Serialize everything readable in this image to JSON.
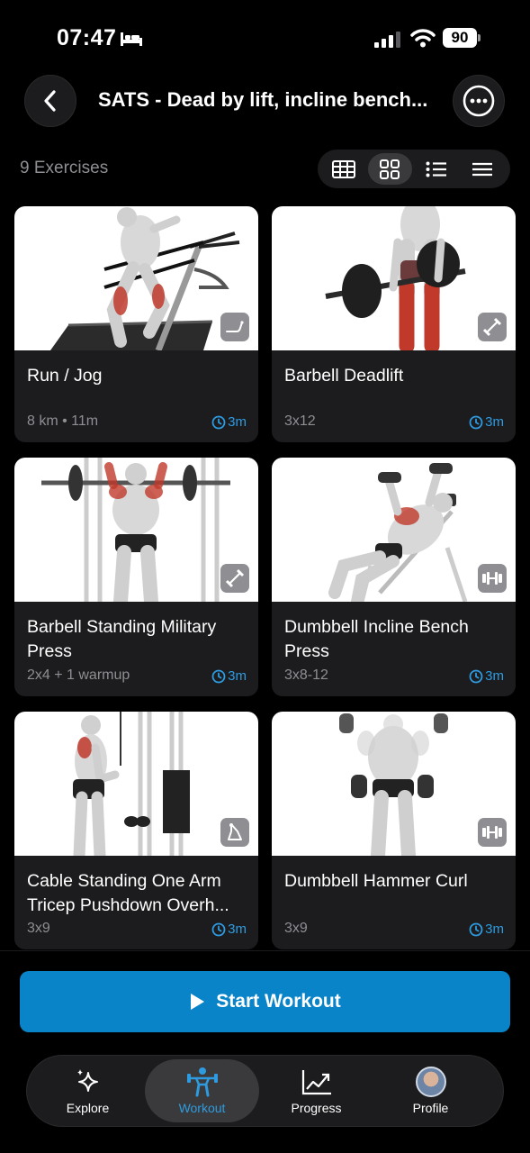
{
  "status_bar": {
    "time": "07:47",
    "battery": "90"
  },
  "header": {
    "title": "SATS - Dead by lift, incline bench..."
  },
  "summary": {
    "count_label": "9 Exercises"
  },
  "view_modes": [
    "table",
    "grid",
    "list",
    "compact"
  ],
  "exercises": [
    {
      "name": "Run / Jog",
      "detail": "8 km • 11m",
      "duration": "3m",
      "equipment_icon": "treadmill-icon"
    },
    {
      "name": "Barbell Deadlift",
      "detail": "3x12",
      "duration": "3m",
      "equipment_icon": "barbell-icon"
    },
    {
      "name": "Barbell Standing Military Press",
      "detail": "2x4 + 1 warmup",
      "duration": "3m",
      "equipment_icon": "barbell-icon"
    },
    {
      "name": "Dumbbell Incline Bench Press",
      "detail": "3x8-12",
      "duration": "3m",
      "equipment_icon": "dumbbell-icon"
    },
    {
      "name": "Cable Standing One Arm Tricep Pushdown Overh...",
      "detail": "3x9",
      "duration": "3m",
      "equipment_icon": "cable-icon"
    },
    {
      "name": "Dumbbell Hammer Curl",
      "detail": "3x9",
      "duration": "3m",
      "equipment_icon": "dumbbell-icon"
    }
  ],
  "actions": {
    "start_label": "Start Workout"
  },
  "tabs": [
    {
      "label": "Explore",
      "icon": "sparkles-icon"
    },
    {
      "label": "Workout",
      "icon": "lifter-icon",
      "active": true
    },
    {
      "label": "Progress",
      "icon": "chart-icon"
    },
    {
      "label": "Profile",
      "icon": "avatar"
    }
  ],
  "colors": {
    "accent": "#2e9be0",
    "button": "#0a84c8",
    "card": "#1c1c1e",
    "muscle": "#c0392b"
  }
}
